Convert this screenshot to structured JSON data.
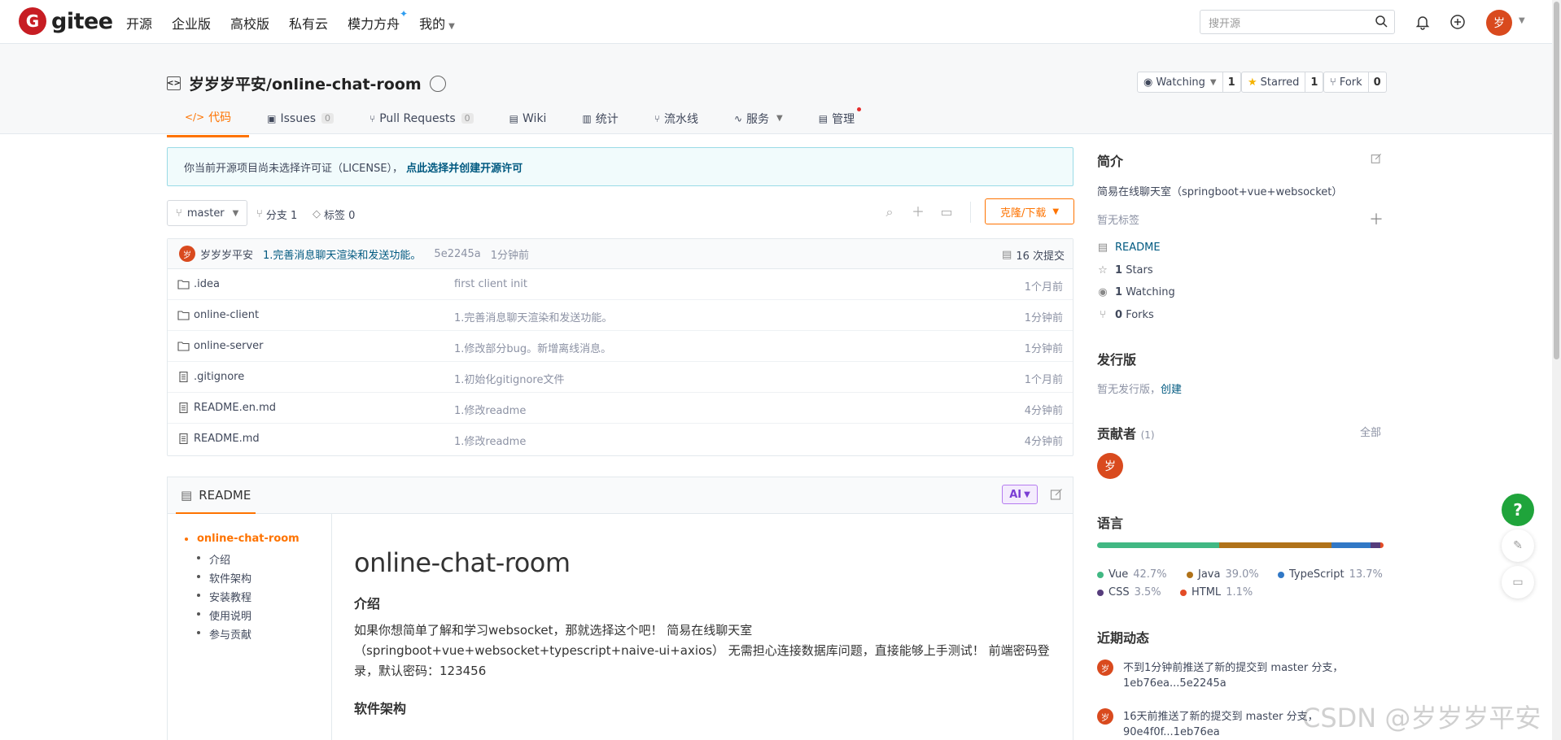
{
  "topnav": {
    "logo_mark": "G",
    "logo_text": "gitee",
    "items": [
      {
        "label": "开源"
      },
      {
        "label": "企业版"
      },
      {
        "label": "高校版"
      },
      {
        "label": "私有云"
      },
      {
        "label": "模力方舟"
      },
      {
        "label": "我的"
      }
    ],
    "search_placeholder": "搜开源",
    "avatar_char": "岁"
  },
  "repo": {
    "title": "岁岁岁平安/online-chat-room",
    "watching_label": "Watching",
    "watching_count": "1",
    "starred_label": "Starred",
    "starred_count": "1",
    "fork_label": "Fork",
    "fork_count": "0"
  },
  "tabs": [
    {
      "label": "代码",
      "glyph": "</>"
    },
    {
      "label": "Issues",
      "glyph": "▣",
      "count": "0"
    },
    {
      "label": "Pull Requests",
      "glyph": "⑂",
      "count": "0"
    },
    {
      "label": "Wiki",
      "glyph": "▤"
    },
    {
      "label": "统计",
      "glyph": "▥"
    },
    {
      "label": "流水线",
      "glyph": "⑂"
    },
    {
      "label": "服务",
      "glyph": "∿"
    },
    {
      "label": "管理",
      "glyph": "▤"
    }
  ],
  "notice": {
    "text": "你当前开源项目尚未选择许可证（LICENSE），",
    "link": "点此选择并创建开源许可"
  },
  "branch": {
    "name": "master",
    "branches": "分支 1",
    "tags": "标签 0",
    "clone_label": "克隆/下载"
  },
  "commit": {
    "avatar": "岁",
    "author": "岁岁岁平安",
    "message": "1.完善消息聊天渲染和发送功能。",
    "hash": "5e2245a",
    "time": "1分钟前",
    "count": "16 次提交"
  },
  "files": [
    {
      "name": ".idea",
      "type": "folder",
      "message": "first client init",
      "time": "1个月前"
    },
    {
      "name": "online-client",
      "type": "folder",
      "message": "1.完善消息聊天渲染和发送功能。",
      "time": "1分钟前"
    },
    {
      "name": "online-server",
      "type": "folder",
      "message": "1.修改部分bug。新增离线消息。",
      "time": "1分钟前"
    },
    {
      "name": ".gitignore",
      "type": "file",
      "message": "1.初始化gitignore文件",
      "time": "1个月前"
    },
    {
      "name": "README.en.md",
      "type": "file",
      "message": "1.修改readme",
      "time": "4分钟前"
    },
    {
      "name": "README.md",
      "type": "file",
      "message": "1.修改readme",
      "time": "4分钟前"
    }
  ],
  "readme": {
    "tab_label": "README",
    "ai_label": "AI",
    "toc": [
      "online-chat-room",
      "介绍",
      "软件架构",
      "安装教程",
      "使用说明",
      "参与贡献"
    ],
    "h1": "online-chat-room",
    "h2_intro": "介绍",
    "intro_p1": "如果你想简单了解和学习websocket，那就选择这个吧！ 简易在线聊天室",
    "intro_p2": "（springboot+vue+websocket+typescript+naive-ui+axios） 无需担心连接数据库问题，直接能够上手测试！ 前端密码登",
    "intro_p3": "录，默认密码：123456",
    "h2_arch": "软件架构"
  },
  "sidebar": {
    "intro_title": "简介",
    "description": "简易在线聊天室（springboot+vue+websocket）",
    "no_tags": "暂无标签",
    "readme_link": "README",
    "stars_num": "1",
    "stars_label": "Stars",
    "watching_num": "1",
    "watching_label": "Watching",
    "forks_num": "0",
    "forks_label": "Forks",
    "release_title": "发行版",
    "release_text": "暂无发行版，",
    "release_link": "创建",
    "contrib_title": "贡献者",
    "contrib_count": "(1)",
    "contrib_all": "全部",
    "contrib_avatar": "岁",
    "lang_title": "语言",
    "languages": [
      {
        "name": "Vue",
        "pct": "42.7%",
        "value": 42.7,
        "color": "#41b883"
      },
      {
        "name": "Java",
        "pct": "39.0%",
        "value": 39.0,
        "color": "#b07219"
      },
      {
        "name": "TypeScript",
        "pct": "13.7%",
        "value": 13.7,
        "color": "#3178c6"
      },
      {
        "name": "CSS",
        "pct": "3.5%",
        "value": 3.5,
        "color": "#563d7c"
      },
      {
        "name": "HTML",
        "pct": "1.1%",
        "value": 1.1,
        "color": "#e34c26"
      }
    ],
    "activity_title": "近期动态",
    "activity": [
      {
        "avatar": "岁",
        "text": "不到1分钟前推送了新的提交到 master 分支，1eb76ea...5e2245a"
      },
      {
        "avatar": "岁",
        "text": "16天前推送了新的提交到 master 分支，90e4f0f...1eb76ea"
      }
    ]
  },
  "floating": {
    "help": "?"
  },
  "watermark": "CSDN @岁岁岁平安"
}
